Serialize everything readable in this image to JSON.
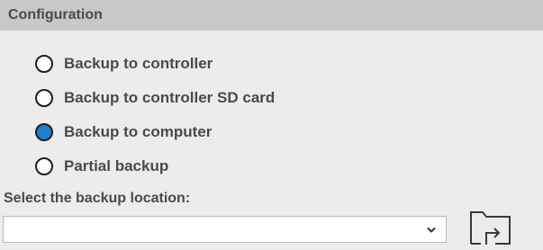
{
  "header": {
    "title": "Configuration"
  },
  "backup_options": [
    {
      "label": "Backup to controller",
      "selected": false
    },
    {
      "label": "Backup to controller SD card",
      "selected": false
    },
    {
      "label": "Backup to computer",
      "selected": true
    },
    {
      "label": "Partial backup",
      "selected": false
    }
  ],
  "location": {
    "label": "Select the backup location:",
    "selected_value": ""
  },
  "icons": {
    "dropdown": "chevron-down-icon",
    "browse": "folder-export-icon"
  },
  "colors": {
    "header_bg": "#c8c8c8",
    "panel_bg": "#ececec",
    "radio_selected": "#1e7fd0",
    "text": "#4a4a4a"
  }
}
